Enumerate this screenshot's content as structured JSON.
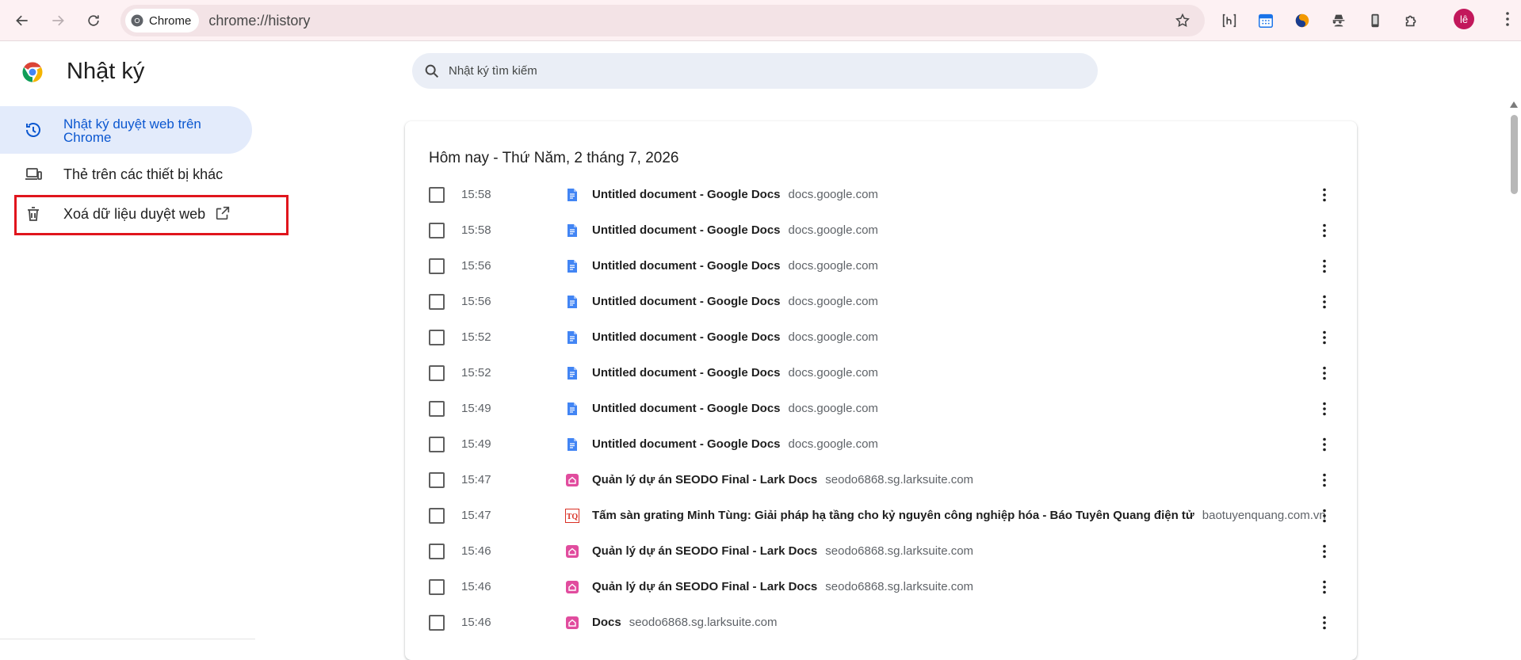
{
  "browser": {
    "chip_label": "Chrome",
    "url": "chrome://history",
    "avatar_text": "lê",
    "extensions": [
      "h-bracket-icon",
      "calendar-icon",
      "yin-yang-icon",
      "spy-icon",
      "phone-icon",
      "puzzle-icon"
    ]
  },
  "page": {
    "title": "Nhật ký",
    "search_placeholder": "Nhật ký tìm kiếm"
  },
  "sidebar": {
    "items": [
      {
        "label": "Nhật ký duyệt web trên Chrome",
        "icon": "history-icon",
        "active": true
      },
      {
        "label": "Thẻ trên các thiết bị khác",
        "icon": "devices-icon",
        "active": false
      },
      {
        "label": "Xoá dữ liệu duyệt web",
        "icon": "trash-icon",
        "active": false
      }
    ]
  },
  "history": {
    "day_title": "Hôm nay - Thứ Năm, 2 tháng 7, 2026",
    "entries": [
      {
        "time": "15:58",
        "title": "Untitled document - Google Docs",
        "domain": "docs.google.com",
        "icon": "docs"
      },
      {
        "time": "15:58",
        "title": "Untitled document - Google Docs",
        "domain": "docs.google.com",
        "icon": "docs"
      },
      {
        "time": "15:56",
        "title": "Untitled document - Google Docs",
        "domain": "docs.google.com",
        "icon": "docs"
      },
      {
        "time": "15:56",
        "title": "Untitled document - Google Docs",
        "domain": "docs.google.com",
        "icon": "docs"
      },
      {
        "time": "15:52",
        "title": "Untitled document - Google Docs",
        "domain": "docs.google.com",
        "icon": "docs"
      },
      {
        "time": "15:52",
        "title": "Untitled document - Google Docs",
        "domain": "docs.google.com",
        "icon": "docs"
      },
      {
        "time": "15:49",
        "title": "Untitled document - Google Docs",
        "domain": "docs.google.com",
        "icon": "docs"
      },
      {
        "time": "15:49",
        "title": "Untitled document - Google Docs",
        "domain": "docs.google.com",
        "icon": "docs"
      },
      {
        "time": "15:47",
        "title": "Quản lý dự án SEODO Final - Lark Docs",
        "domain": "seodo6868.sg.larksuite.com",
        "icon": "lark"
      },
      {
        "time": "15:47",
        "title": "Tấm sàn grating Minh Tùng: Giải pháp hạ tầng cho kỷ nguyên công nghiệp hóa - Báo Tuyên Quang điện tử",
        "domain": "baotuyenquang.com.vn",
        "icon": "tq",
        "icon_text": "TQ"
      },
      {
        "time": "15:46",
        "title": "Quản lý dự án SEODO Final - Lark Docs",
        "domain": "seodo6868.sg.larksuite.com",
        "icon": "lark"
      },
      {
        "time": "15:46",
        "title": "Quản lý dự án SEODO Final - Lark Docs",
        "domain": "seodo6868.sg.larksuite.com",
        "icon": "lark"
      },
      {
        "time": "15:46",
        "title": "Docs",
        "domain": "seodo6868.sg.larksuite.com",
        "icon": "lark"
      }
    ]
  },
  "colors": {
    "accent": "#0b57d0",
    "active_bg": "#e3ebfb",
    "highlight_border": "#e0151d",
    "toolbar_bg": "#fdf1f3",
    "docs_blue": "#4285f4",
    "lark_pink": "#e14c9e"
  }
}
